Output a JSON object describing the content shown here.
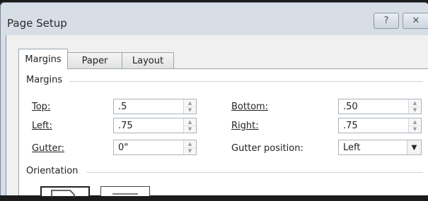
{
  "window": {
    "title": "Page Setup",
    "help_glyph": "?",
    "close_glyph": "✕"
  },
  "tabs": [
    {
      "label": "Margins",
      "active": true
    },
    {
      "label": "Paper",
      "active": false
    },
    {
      "label": "Layout",
      "active": false
    }
  ],
  "margins_section": {
    "heading": "Margins",
    "top": {
      "label": "Top:",
      "value": ".5"
    },
    "bottom": {
      "label": "Bottom:",
      "value": ".50"
    },
    "left": {
      "label": "Left:",
      "value": ".75"
    },
    "right": {
      "label": "Right:",
      "value": ".75"
    },
    "gutter": {
      "label": "Gutter:",
      "value": "0\""
    },
    "gutter_position": {
      "label": "Gutter position:",
      "value": "Left"
    }
  },
  "orientation_section": {
    "heading": "Orientation",
    "selected": "portrait"
  },
  "colors": {
    "frame": "#d7dee6",
    "panel": "#ffffff"
  }
}
